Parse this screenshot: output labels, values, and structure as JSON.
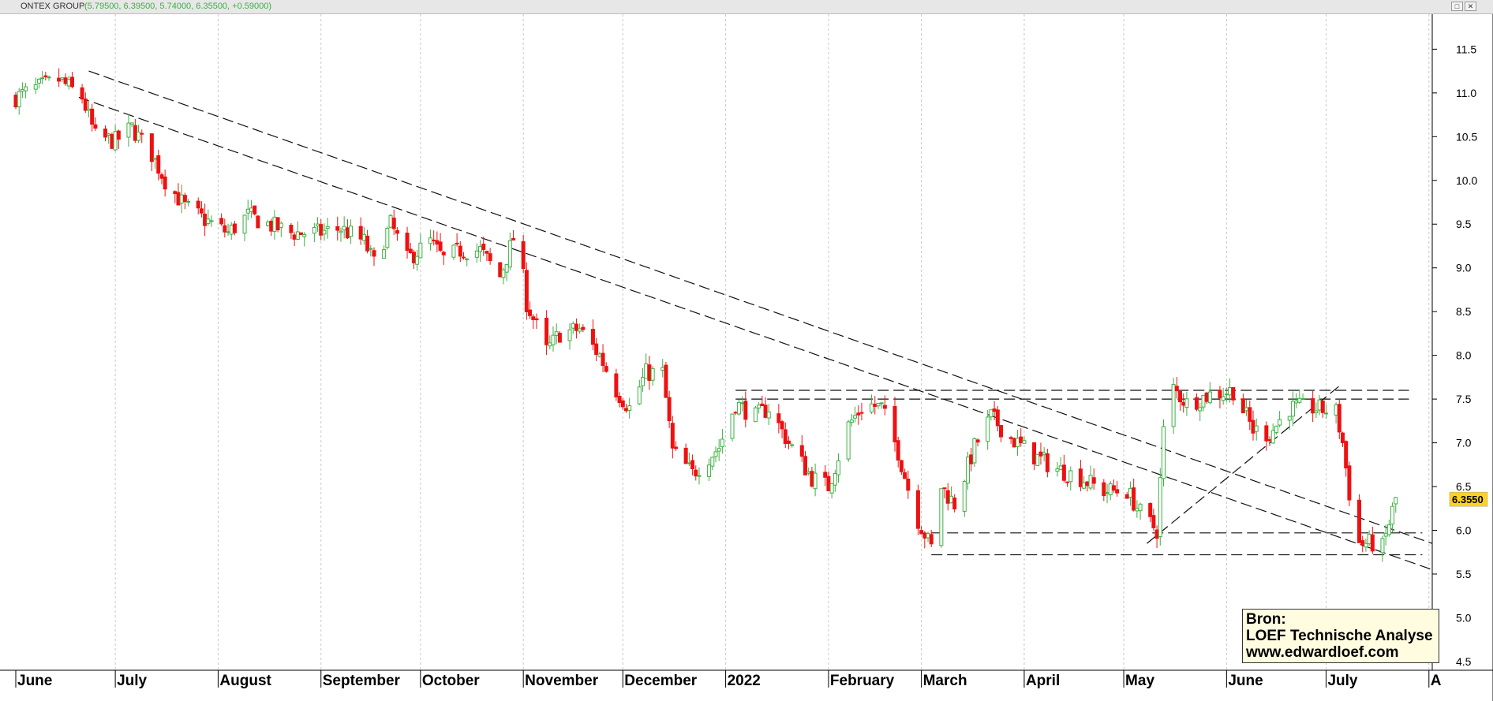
{
  "window": {
    "title": "ONTEX GROUP",
    "ohlc_readout": "(5.79500, 6.39500, 5.74000, 6.35500, +0.59000)",
    "restore_icon": "restore-icon",
    "close_icon": "close-icon"
  },
  "source_box": {
    "line1": "Bron:",
    "line2": "LOEF Technische Analyse",
    "line3": "www.edwardloef.com"
  },
  "chart_data": {
    "type": "candlestick",
    "title": "ONTEX GROUP",
    "y_range": [
      4.4,
      11.9
    ],
    "y_ticks": [
      "4.5",
      "5.0",
      "5.5",
      "6.0",
      "6.5",
      "7.0",
      "7.5",
      "8.0",
      "8.5",
      "9.0",
      "9.5",
      "10.0",
      "10.5",
      "11.0",
      "11.5"
    ],
    "x_range": [
      "2021-06-01",
      "2022-08-02"
    ],
    "x_labels": [
      {
        "label": "June",
        "date": "2021-06-01"
      },
      {
        "label": "July",
        "date": "2021-07-01"
      },
      {
        "label": "August",
        "date": "2021-08-01"
      },
      {
        "label": "September",
        "date": "2021-09-01"
      },
      {
        "label": "October",
        "date": "2021-10-01"
      },
      {
        "label": "November",
        "date": "2021-11-01"
      },
      {
        "label": "December",
        "date": "2021-12-01"
      },
      {
        "label": "2022",
        "date": "2022-01-01"
      },
      {
        "label": "February",
        "date": "2022-02-01"
      },
      {
        "label": "March",
        "date": "2022-03-01"
      },
      {
        "label": "April",
        "date": "2022-04-01"
      },
      {
        "label": "May",
        "date": "2022-05-01"
      },
      {
        "label": "June",
        "date": "2022-06-01"
      },
      {
        "label": "July",
        "date": "2022-07-01"
      },
      {
        "label": "A",
        "date": "2022-08-01"
      }
    ],
    "last_price_label": "6.3550",
    "last_price": 6.355,
    "up_color": "#3cb043",
    "down_color": "#ee1111",
    "price_path": [
      [
        "2021-06-01",
        10.95
      ],
      [
        "2021-06-07",
        11.05
      ],
      [
        "2021-06-14",
        11.15
      ],
      [
        "2021-06-21",
        10.95
      ],
      [
        "2021-06-25",
        10.5
      ],
      [
        "2021-07-01",
        10.45
      ],
      [
        "2021-07-06",
        10.6
      ],
      [
        "2021-07-12",
        10.3
      ],
      [
        "2021-07-16",
        10.0
      ],
      [
        "2021-07-22",
        9.7
      ],
      [
        "2021-07-28",
        9.55
      ],
      [
        "2021-08-04",
        9.4
      ],
      [
        "2021-08-10",
        9.6
      ],
      [
        "2021-08-16",
        9.5
      ],
      [
        "2021-08-23",
        9.4
      ],
      [
        "2021-08-31",
        9.4
      ],
      [
        "2021-09-07",
        9.45
      ],
      [
        "2021-09-14",
        9.3
      ],
      [
        "2021-09-17",
        9.05
      ],
      [
        "2021-09-22",
        9.5
      ],
      [
        "2021-09-27",
        9.1
      ],
      [
        "2021-10-04",
        9.3
      ],
      [
        "2021-10-08",
        9.1
      ],
      [
        "2021-10-13",
        9.2
      ],
      [
        "2021-10-19",
        9.2
      ],
      [
        "2021-10-25",
        8.9
      ],
      [
        "2021-10-30",
        9.45
      ],
      [
        "2021-11-02",
        8.6
      ],
      [
        "2021-11-08",
        8.05
      ],
      [
        "2021-11-12",
        8.25
      ],
      [
        "2021-11-18",
        8.3
      ],
      [
        "2021-11-24",
        8.0
      ],
      [
        "2021-11-29",
        7.6
      ],
      [
        "2021-12-03",
        7.4
      ],
      [
        "2021-12-08",
        7.8
      ],
      [
        "2021-12-13",
        7.8
      ],
      [
        "2021-12-16",
        6.9
      ],
      [
        "2021-12-22",
        6.65
      ],
      [
        "2021-12-30",
        6.95
      ],
      [
        "2022-01-04",
        7.45
      ],
      [
        "2022-01-10",
        7.3
      ],
      [
        "2022-01-14",
        7.4
      ],
      [
        "2022-01-20",
        7.0
      ],
      [
        "2022-01-27",
        6.6
      ],
      [
        "2022-02-01",
        6.5
      ],
      [
        "2022-02-07",
        7.2
      ],
      [
        "2022-02-12",
        7.45
      ],
      [
        "2022-02-17",
        7.4
      ],
      [
        "2022-02-22",
        6.9
      ],
      [
        "2022-02-27",
        6.2
      ],
      [
        "2022-03-04",
        5.8
      ],
      [
        "2022-03-07",
        6.5
      ],
      [
        "2022-03-11",
        6.3
      ],
      [
        "2022-03-17",
        6.95
      ],
      [
        "2022-03-22",
        7.3
      ],
      [
        "2022-03-28",
        7.05
      ],
      [
        "2022-04-04",
        6.85
      ],
      [
        "2022-04-11",
        6.7
      ],
      [
        "2022-04-18",
        6.6
      ],
      [
        "2022-04-25",
        6.45
      ],
      [
        "2022-05-02",
        6.45
      ],
      [
        "2022-05-06",
        6.2
      ],
      [
        "2022-05-11",
        6.0
      ],
      [
        "2022-05-14",
        7.7
      ],
      [
        "2022-05-20",
        7.45
      ],
      [
        "2022-05-27",
        7.55
      ],
      [
        "2022-06-03",
        7.6
      ],
      [
        "2022-06-09",
        7.15
      ],
      [
        "2022-06-14",
        7.1
      ],
      [
        "2022-06-20",
        7.4
      ],
      [
        "2022-06-27",
        7.4
      ],
      [
        "2022-07-04",
        7.35
      ],
      [
        "2022-07-06",
        7.0
      ],
      [
        "2022-07-10",
        5.85
      ],
      [
        "2022-07-15",
        5.85
      ],
      [
        "2022-07-18",
        5.8
      ],
      [
        "2022-07-22",
        6.36
      ]
    ],
    "trendlines": [
      {
        "style": "dashed",
        "from": [
          "2021-06-23",
          11.25
        ],
        "to": [
          "2022-08-02",
          5.85
        ]
      },
      {
        "style": "dashed",
        "from": [
          "2021-06-20",
          10.95
        ],
        "to": [
          "2022-08-02",
          5.55
        ]
      },
      {
        "style": "dashed",
        "from": [
          "2022-05-08",
          5.85
        ],
        "to": [
          "2022-07-05",
          7.65
        ]
      },
      {
        "style": "dashed",
        "from": [
          "2022-01-04",
          7.6
        ],
        "to": [
          "2022-07-26",
          7.6
        ]
      },
      {
        "style": "dashed",
        "from": [
          "2022-01-04",
          7.5
        ],
        "to": [
          "2022-07-26",
          7.5
        ]
      },
      {
        "style": "dashed",
        "from": [
          "2022-03-04",
          5.97
        ],
        "to": [
          "2022-07-30",
          5.97
        ]
      },
      {
        "style": "dashed",
        "from": [
          "2022-03-04",
          5.72
        ],
        "to": [
          "2022-07-30",
          5.72
        ]
      }
    ]
  }
}
